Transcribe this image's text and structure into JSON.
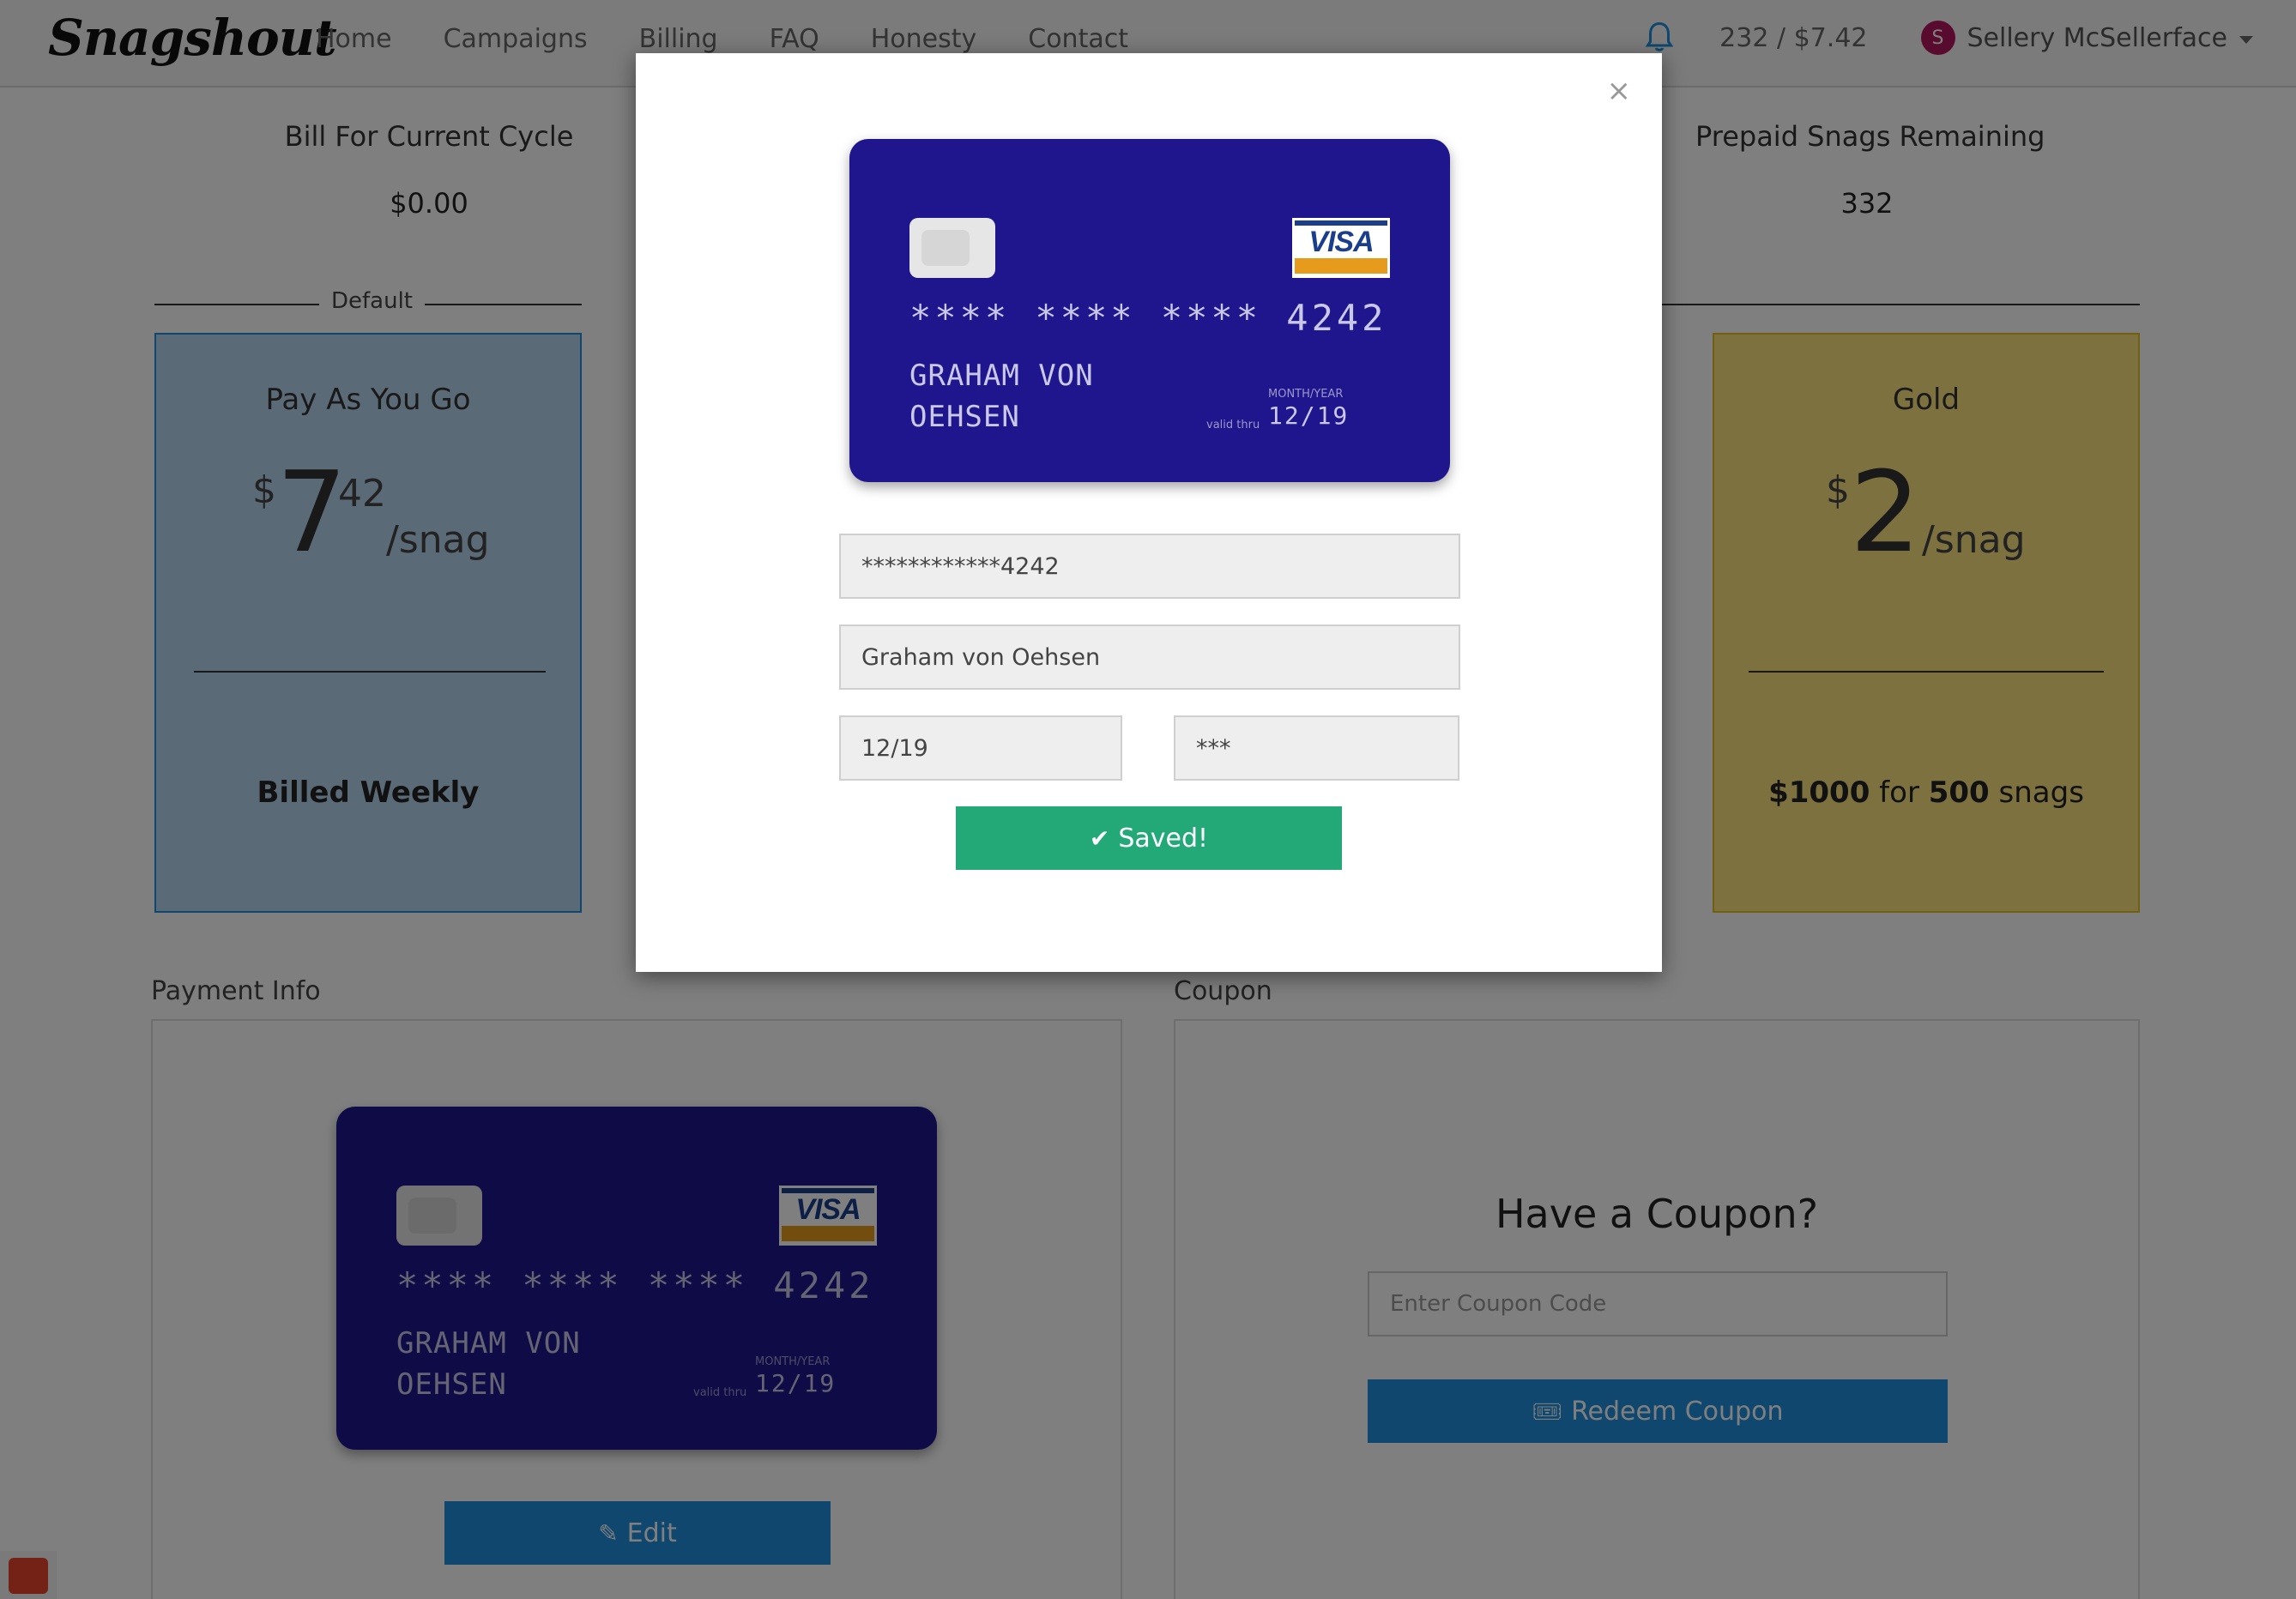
{
  "nav": {
    "brand": "Snagshout",
    "links": [
      "Home",
      "Campaigns",
      "Billing",
      "FAQ",
      "Honesty",
      "Contact"
    ],
    "balance": "232 / $7.42",
    "user_initial": "S",
    "user_name": "Sellery McSellerface"
  },
  "stats": {
    "bill_label": "Bill For Current Cycle",
    "bill_value": "$0.00",
    "prepaid_label": "Prepaid Snags Remaining",
    "prepaid_value": "332"
  },
  "plans": {
    "default_label": "Default",
    "pay_as_you_go": {
      "name": "Pay As You Go",
      "currency": "$",
      "price_whole": "7",
      "price_cents": "42",
      "unit": "/snag",
      "billing": "Billed Weekly"
    },
    "gold": {
      "name": "Gold",
      "currency": "$",
      "price_whole": "2",
      "unit": "/snag",
      "amount": "$1000",
      "for_text": "for",
      "count": "500",
      "snags_text": "snags"
    }
  },
  "payment": {
    "section_title": "Payment Info",
    "card_number": "**** **** **** 4242",
    "card_name_line1": "GRAHAM VON",
    "card_name_line2": "OEHSEN",
    "month_year_label": "MONTH/YEAR",
    "valid_thru_label": "valid thru",
    "expiry": "12/19",
    "brand_text": "VISA",
    "edit_label": "Edit"
  },
  "coupon": {
    "section_title": "Coupon",
    "heading": "Have a Coupon?",
    "placeholder": "Enter Coupon Code",
    "redeem_label": "Redeem Coupon"
  },
  "modal": {
    "close": "×",
    "card_number_field": "************4242",
    "name_field": "Graham von Oehsen",
    "expiry_field": "12/19",
    "cvc_field": "***",
    "saved_label": "Saved!"
  },
  "colors": {
    "card_blue": "#1f168e",
    "plan_blue": "#b7d5ee",
    "plan_gold": "#f8e27e",
    "accent_blue": "#1f8fdc",
    "success_green": "#23a877"
  }
}
